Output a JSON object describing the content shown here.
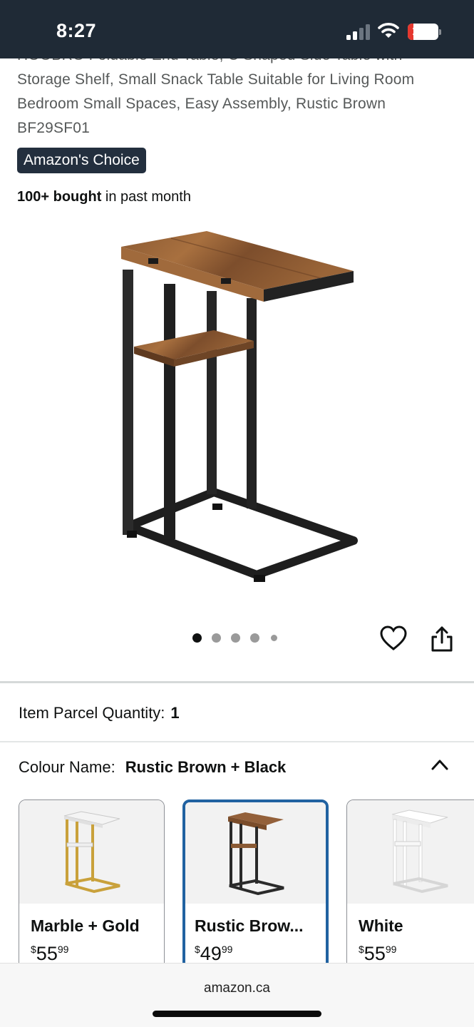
{
  "status_bar": {
    "time": "8:27",
    "battery": "19",
    "battery_level_percent": 19,
    "battery_color": "#e5372e"
  },
  "product": {
    "title": "HOOBRO Foldable End Table, C Shaped Side Table with Storage Shelf, Small Snack Table Suitable for Living Room Bedroom Small Spaces, Easy Assembly, Rustic Brown BF29SF01",
    "badge": "Amazon's Choice",
    "bought_bold": "100+ bought",
    "bought_rest": " in past month",
    "image_count": 5,
    "active_image": 1
  },
  "actions": {
    "favorite_icon": "heart-icon",
    "share_icon": "share-icon"
  },
  "parcel": {
    "label": "Item Parcel Quantity:",
    "value": "1"
  },
  "colour": {
    "label": "Colour Name:",
    "value": "Rustic Brown + Black",
    "expanded_icon": "chevron-up-icon",
    "options": [
      {
        "name": "Marble + Gold",
        "currency": "$",
        "whole": "55",
        "cents": "99",
        "selected": false
      },
      {
        "name": "Rustic Brow...",
        "currency": "$",
        "whole": "49",
        "cents": "99",
        "selected": true
      },
      {
        "name": "White",
        "currency": "$",
        "whole": "55",
        "cents": "99",
        "selected": false
      }
    ]
  },
  "browser": {
    "url": "amazon.ca"
  },
  "colors": {
    "badge_bg": "#232f3e",
    "selected_border": "#2162a1",
    "status_bg": "#1f2a36"
  }
}
